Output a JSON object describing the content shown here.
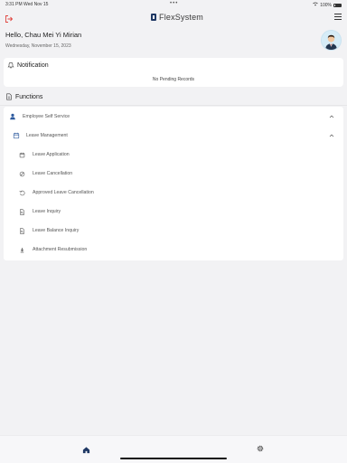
{
  "status_bar": {
    "time_date": "3:31 PM   Wed Nov 15",
    "dots": "•••",
    "battery": "100%"
  },
  "header": {
    "brand_name": "FlexSystem"
  },
  "greeting": {
    "hello": "Hello, Chau Mei Yi Mirian",
    "date": "Wednesday, November 15, 2023"
  },
  "notification": {
    "title": "Notification",
    "empty_text": "No Pending Records"
  },
  "functions": {
    "title": "Functions",
    "groups": [
      {
        "label": "Employee Self Service",
        "icon": "person-icon",
        "expanded": true,
        "subgroups": [
          {
            "label": "Leave Management",
            "icon": "calendar-icon",
            "expanded": true,
            "items": [
              {
                "label": "Leave Application",
                "icon": "calendar-icon"
              },
              {
                "label": "Leave Cancellation",
                "icon": "cancel-icon"
              },
              {
                "label": "Approved Leave Cancellation",
                "icon": "undo-icon"
              },
              {
                "label": "Leave Inquiry",
                "icon": "document-search-icon"
              },
              {
                "label": "Leave Balance Inquiry",
                "icon": "document-search-icon"
              },
              {
                "label": "Attachment Resubmission",
                "icon": "upload-icon"
              }
            ]
          }
        ]
      }
    ]
  },
  "bottom_nav": {
    "items": [
      {
        "name": "home",
        "icon": "home-icon",
        "active": true
      },
      {
        "name": "settings",
        "icon": "gear-icon",
        "active": false
      }
    ]
  },
  "colors": {
    "accent": "#1f3864",
    "logout": "#e0443e",
    "background": "#f2f2f4",
    "card": "#ffffff"
  }
}
